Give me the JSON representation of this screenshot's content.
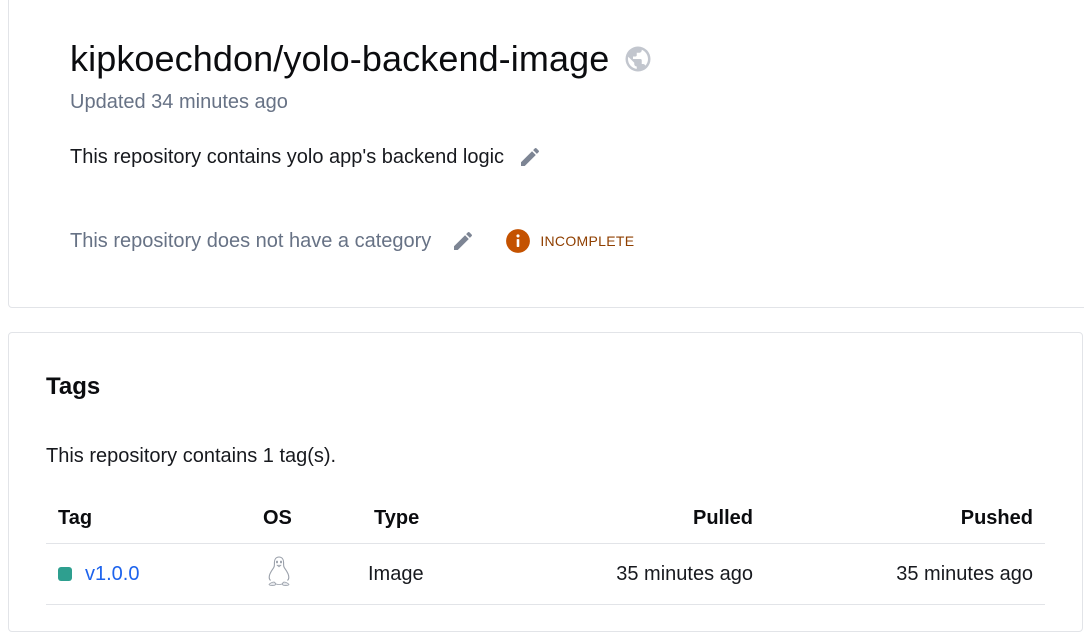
{
  "repo": {
    "title": "kipkoechdon/yolo-backend-image",
    "visibility_icon": "globe-icon",
    "updated": "Updated 34 minutes ago",
    "description": "This repository contains yolo app's backend logic",
    "category_text": "This repository does not have a category",
    "category_status": "INCOMPLETE"
  },
  "tags": {
    "heading": "Tags",
    "count_text": "This repository contains 1 tag(s).",
    "columns": {
      "tag": "Tag",
      "os": "OS",
      "type": "Type",
      "pulled": "Pulled",
      "pushed": "Pushed"
    },
    "rows": [
      {
        "tag": "v1.0.0",
        "os_icon": "linux-icon",
        "type": "Image",
        "pulled": "35 minutes ago",
        "pushed": "35 minutes ago"
      }
    ]
  },
  "colors": {
    "link": "#1d63ed",
    "status_dot": "#2e9f8f",
    "badge_icon": "#c45200",
    "badge_text": "#8f3f00",
    "muted_text": "#677285"
  }
}
